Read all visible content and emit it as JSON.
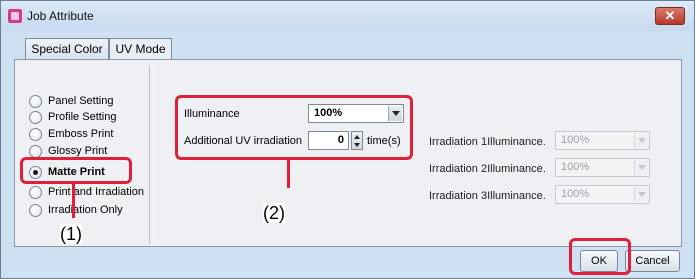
{
  "window": {
    "title": "Job Attribute",
    "close_label": "✕"
  },
  "tabs": [
    {
      "label": "Special Color",
      "active": false
    },
    {
      "label": "UV Mode",
      "active": true
    }
  ],
  "modes": [
    {
      "label": "Panel Setting",
      "selected": false
    },
    {
      "label": "Profile Setting",
      "selected": false
    },
    {
      "label": "Emboss Print",
      "selected": false
    },
    {
      "label": "Glossy Print",
      "selected": false
    },
    {
      "label": "Matte Print",
      "selected": true
    },
    {
      "label": "Print and Irradiation",
      "selected": false
    },
    {
      "label": "Irradiation Only",
      "selected": false
    }
  ],
  "settings": {
    "illuminance_label": "Illuminance",
    "illuminance_value": "100%",
    "additional_uv_label": "Additional UV irradiation",
    "additional_uv_value": "0",
    "additional_uv_unit": "time(s)"
  },
  "irradiation": [
    {
      "label": "Irradiation 1Illuminance.",
      "value": "100%"
    },
    {
      "label": "Irradiation 2Illuminance.",
      "value": "100%"
    },
    {
      "label": "Irradiation 3Illuminance.",
      "value": "100%"
    }
  ],
  "buttons": {
    "ok": "OK",
    "cancel": "Cancel"
  },
  "callouts": {
    "one": "(1)",
    "two": "(2)"
  },
  "colors": {
    "callout": "#e0203a",
    "window_bg": "#cfe0f2",
    "panel_bg": "#eef0f3"
  }
}
